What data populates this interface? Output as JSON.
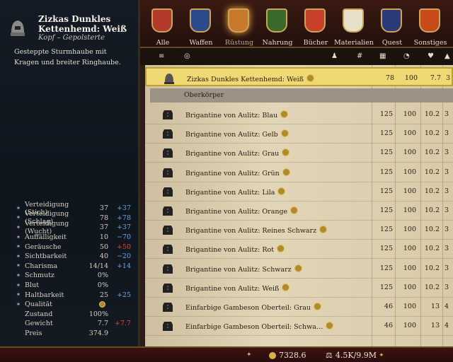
{
  "item": {
    "title": "Zizkas Dunkles Kettenhemd: Weiß",
    "category": "Kopf – Gepolsterte",
    "description": "Gesteppte Sturmhaube mit Kragen und breiter Ringhaube."
  },
  "stats": [
    {
      "label": "Verteidigung (Stich)",
      "value": "37",
      "diff": "+37",
      "sign": "pos",
      "icon": "stab-icon"
    },
    {
      "label": "Verteidigung (Schlag)",
      "value": "78",
      "diff": "+78",
      "sign": "pos",
      "icon": "slash-icon"
    },
    {
      "label": "Verteidigung (Wucht)",
      "value": "37",
      "diff": "+37",
      "sign": "pos",
      "icon": "blunt-icon"
    },
    {
      "label": "Auffälligkeit",
      "value": "10",
      "diff": "−70",
      "sign": "pos",
      "icon": "conspicuousness-icon"
    },
    {
      "label": "Geräusche",
      "value": "50",
      "diff": "+50",
      "sign": "neg",
      "icon": "noise-icon"
    },
    {
      "label": "Sichtbarkeit",
      "value": "40",
      "diff": "−20",
      "sign": "pos",
      "icon": "visibility-icon"
    },
    {
      "label": "Charisma",
      "value": "14/14",
      "diff": "+14",
      "sign": "pos",
      "icon": "charisma-icon"
    },
    {
      "label": "Schmutz",
      "value": "0%",
      "diff": "",
      "sign": "",
      "icon": "dirt-icon"
    },
    {
      "label": "Blut",
      "value": "0%",
      "diff": "",
      "sign": "",
      "icon": "blood-icon"
    },
    {
      "label": "Haltbarkeit",
      "value": "25",
      "diff": "+25",
      "sign": "pos",
      "icon": "durability-icon"
    },
    {
      "label": "Qualität",
      "value": "",
      "diff": "",
      "sign": "",
      "icon": "quality-icon",
      "token": true
    },
    {
      "label": "Zustand",
      "value": "100%",
      "diff": "",
      "sign": "",
      "icon": ""
    },
    {
      "label": "Gewicht",
      "value": "7.7",
      "diff": "+7.7",
      "sign": "neg",
      "icon": ""
    },
    {
      "label": "Preis",
      "value": "374.9",
      "diff": "",
      "sign": "",
      "icon": ""
    }
  ],
  "tabs": [
    {
      "label": "Alle",
      "color": "#b23a2a"
    },
    {
      "label": "Waffen",
      "color": "#2a4a8a"
    },
    {
      "label": "Rüstung",
      "color": "#c8782a",
      "active": true
    },
    {
      "label": "Nahrung",
      "color": "#3a6a2a"
    },
    {
      "label": "Bücher",
      "color": "#c8402a"
    },
    {
      "label": "Materialien",
      "color": "#e8e0c8"
    },
    {
      "label": "Quest",
      "color": "#2a3a7a"
    },
    {
      "label": "Sonstiges",
      "color": "#c84a1a"
    }
  ],
  "selected_row": {
    "name": "Zizkas Dunkles Kettenhemd: Weiß",
    "c1": "78",
    "c2": "100",
    "c3": "7.7",
    "c4": "3"
  },
  "section_label": "Oberkörper",
  "rows": [
    {
      "name": "Brigantine von Aulitz: Blau",
      "c1": "125",
      "c2": "100",
      "c3": "10.2",
      "c4": "3"
    },
    {
      "name": "Brigantine von Aulitz: Gelb",
      "c1": "125",
      "c2": "100",
      "c3": "10.2",
      "c4": "3"
    },
    {
      "name": "Brigantine von Aulitz: Grau",
      "c1": "125",
      "c2": "100",
      "c3": "10.2",
      "c4": "3"
    },
    {
      "name": "Brigantine von Aulitz: Grün",
      "c1": "125",
      "c2": "100",
      "c3": "10.2",
      "c4": "3"
    },
    {
      "name": "Brigantine von Aulitz: Lila",
      "c1": "125",
      "c2": "100",
      "c3": "10.2",
      "c4": "3"
    },
    {
      "name": "Brigantine von Aulitz: Orange",
      "c1": "125",
      "c2": "100",
      "c3": "10.2",
      "c4": "3"
    },
    {
      "name": "Brigantine von Aulitz: Reines Schwarz",
      "c1": "125",
      "c2": "100",
      "c3": "10.2",
      "c4": "3"
    },
    {
      "name": "Brigantine von Aulitz: Rot",
      "c1": "125",
      "c2": "100",
      "c3": "10.2",
      "c4": "3"
    },
    {
      "name": "Brigantine von Aulitz: Schwarz",
      "c1": "125",
      "c2": "100",
      "c3": "10.2",
      "c4": "3"
    },
    {
      "name": "Brigantine von Aulitz: Weiß",
      "c1": "125",
      "c2": "100",
      "c3": "10.2",
      "c4": "3"
    },
    {
      "name": "Einfarbige Gambeson Oberteil: Grau",
      "c1": "46",
      "c2": "100",
      "c3": "13",
      "c4": "4"
    },
    {
      "name": "Einfarbige Gambeson Oberteil: Schwa…",
      "c1": "46",
      "c2": "100",
      "c3": "13",
      "c4": "4"
    }
  ],
  "footer": {
    "groschen": "7328.6",
    "weight": "4.5K/9.9M"
  }
}
